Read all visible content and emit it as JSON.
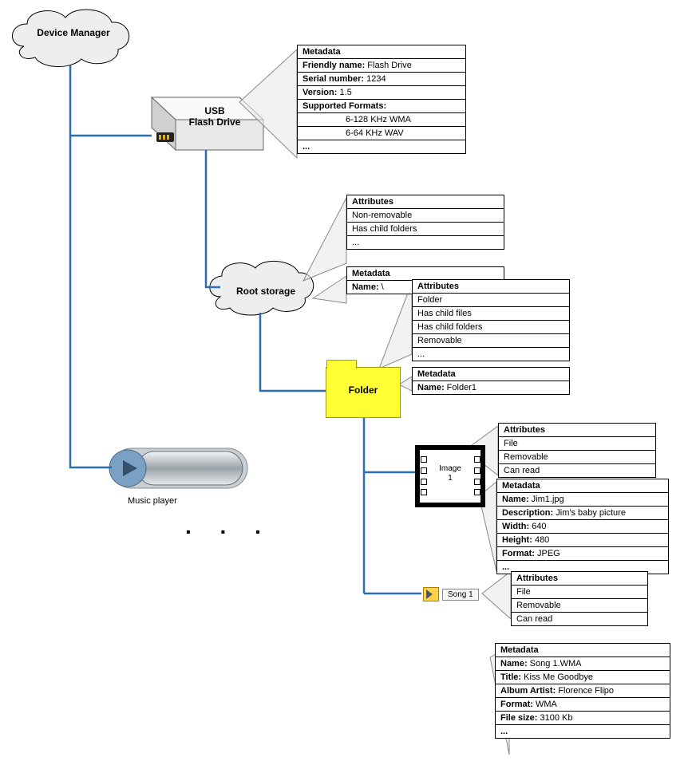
{
  "nodes": {
    "device_manager": "Device Manager",
    "usb_flash_drive_l1": "USB",
    "usb_flash_drive_l2": "Flash Drive",
    "root_storage": "Root storage",
    "folder": "Folder",
    "image1_l1": "Image",
    "image1_l2": "1",
    "song1": "Song 1",
    "music_player": "Music player",
    "dots": ". . ."
  },
  "tables": {
    "usb_metadata": {
      "header": "Metadata",
      "rows": [
        {
          "k": "Friendly name:",
          "v": " Flash Drive"
        },
        {
          "k": "Serial number:",
          "v": " 1234"
        },
        {
          "k": "Version:",
          "v": " 1.5"
        },
        {
          "k": "Supported Formats:",
          "v": ""
        },
        {
          "k": "",
          "v": "6-128 KHz WMA",
          "indent": true
        },
        {
          "k": "",
          "v": "6-64 KHz WAV",
          "indent": true
        },
        {
          "k": "...",
          "v": ""
        }
      ]
    },
    "root_attributes": {
      "header": "Attributes",
      "rows": [
        {
          "v": "Non-removable"
        },
        {
          "v": "Has child folders"
        },
        {
          "v": "..."
        }
      ]
    },
    "root_metadata": {
      "header": "Metadata",
      "rows": [
        {
          "k": "Name:",
          "v": " \\"
        }
      ]
    },
    "folder_attributes": {
      "header": "Attributes",
      "rows": [
        {
          "v": "Folder"
        },
        {
          "v": "Has child files"
        },
        {
          "v": "Has child folders"
        },
        {
          "v": "Removable"
        },
        {
          "v": "..."
        }
      ]
    },
    "folder_metadata": {
      "header": "Metadata",
      "rows": [
        {
          "k": "Name:",
          "v": " Folder1"
        }
      ]
    },
    "image_attributes": {
      "header": "Attributes",
      "rows": [
        {
          "v": "File"
        },
        {
          "v": "Removable"
        },
        {
          "v": "Can read"
        }
      ]
    },
    "image_metadata": {
      "header": "Metadata",
      "rows": [
        {
          "k": "Name:",
          "v": " Jim1.jpg"
        },
        {
          "k": "Description:",
          "v": " Jim's baby picture"
        },
        {
          "k": "Width:",
          "v": " 640"
        },
        {
          "k": "Height:",
          "v": " 480"
        },
        {
          "k": "Format:",
          "v": " JPEG"
        },
        {
          "k": "...",
          "v": ""
        }
      ]
    },
    "song_attributes": {
      "header": "Attributes",
      "rows": [
        {
          "v": "File"
        },
        {
          "v": "Removable"
        },
        {
          "v": "Can read"
        }
      ]
    },
    "song_metadata": {
      "header": "Metadata",
      "rows": [
        {
          "k": "Name:",
          "v": " Song 1.WMA"
        },
        {
          "k": "Title:",
          "v": " Kiss Me Goodbye"
        },
        {
          "k": "Album Artist:",
          "v": " Florence Flipo"
        },
        {
          "k": "Format:",
          "v": " WMA"
        },
        {
          "k": "File size:",
          "v": " 3100 Kb"
        },
        {
          "k": "...",
          "v": ""
        }
      ]
    }
  }
}
